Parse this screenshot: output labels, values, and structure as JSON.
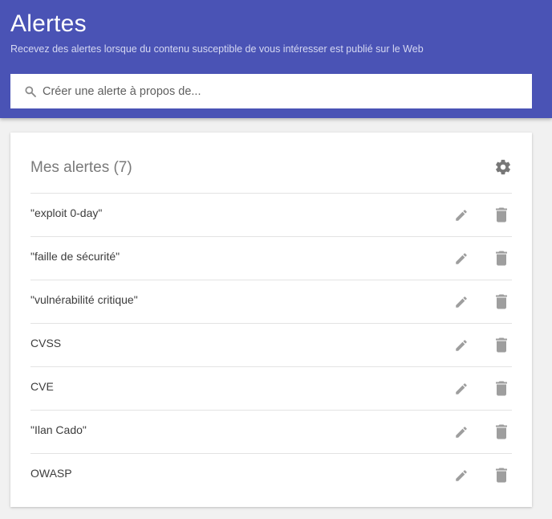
{
  "header": {
    "title": "Alertes",
    "subtitle": "Recevez des alertes lorsque du contenu susceptible de vous intéresser est publié sur le Web",
    "background": "#4a53b5"
  },
  "search": {
    "placeholder": "Créer une alerte à propos de...",
    "value": "",
    "icon": "search-icon"
  },
  "alerts_card": {
    "title": "Mes alertes",
    "count": "(7)",
    "settings_icon": "gear-icon",
    "items": [
      {
        "label": "\"exploit 0-day\""
      },
      {
        "label": "\"faille de sécurité\""
      },
      {
        "label": "\"vulnérabilité critique\""
      },
      {
        "label": "CVSS"
      },
      {
        "label": "CVE"
      },
      {
        "label": "\"Ilan Cado\""
      },
      {
        "label": "OWASP"
      }
    ],
    "row_icons": {
      "edit": "pencil-icon",
      "delete": "trash-icon"
    }
  }
}
